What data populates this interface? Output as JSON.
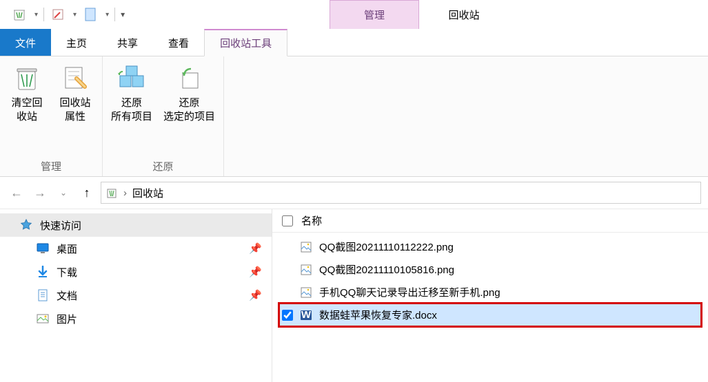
{
  "titlebar": {
    "context_tab": "管理",
    "window_title": "回收站"
  },
  "menutabs": {
    "file": "文件",
    "home": "主页",
    "share": "共享",
    "view": "查看",
    "tools": "回收站工具"
  },
  "ribbon": {
    "group_manage": {
      "title": "管理",
      "empty": "清空回\n收站",
      "props": "回收站\n属性"
    },
    "group_restore": {
      "title": "还原",
      "restore_all": "还原\n所有项目",
      "restore_sel": "还原\n选定的项目"
    }
  },
  "address": {
    "location": "回收站",
    "sep": "›"
  },
  "nav": {
    "quick_access": "快速访问",
    "desktop": "桌面",
    "downloads": "下载",
    "documents": "文档",
    "pictures": "图片"
  },
  "list": {
    "col_name": "名称",
    "items": [
      {
        "name": "QQ截图20211110112222.png",
        "type": "image",
        "selected": false,
        "highlighted": false
      },
      {
        "name": "QQ截图20211110105816.png",
        "type": "image",
        "selected": false,
        "highlighted": false
      },
      {
        "name": "手机QQ聊天记录导出迁移至新手机.png",
        "type": "image",
        "selected": false,
        "highlighted": false
      },
      {
        "name": "数据蛙苹果恢复专家.docx",
        "type": "word",
        "selected": true,
        "highlighted": true
      }
    ]
  }
}
